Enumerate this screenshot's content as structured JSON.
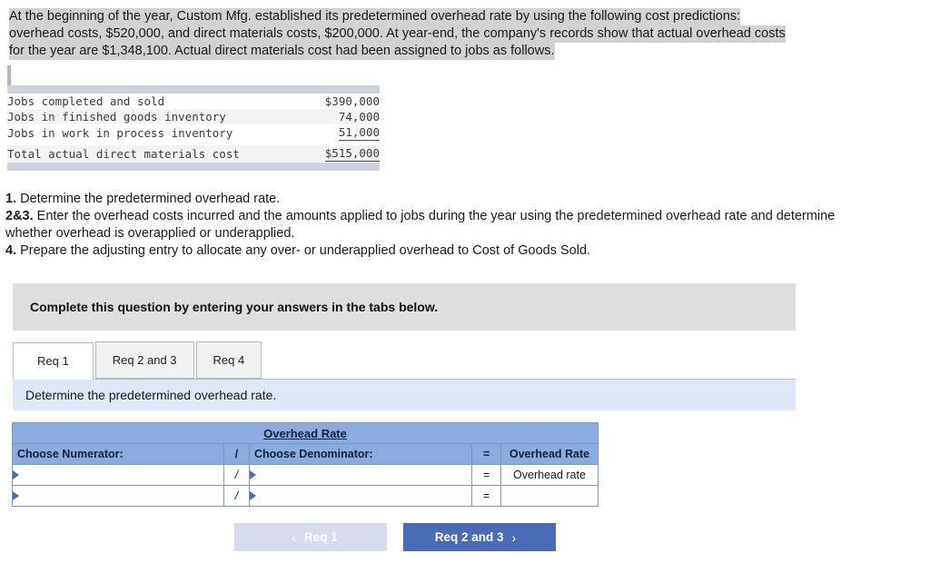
{
  "problem": {
    "line1": "At the beginning of the year, Custom Mfg. established its predetermined overhead rate by using the following cost predictions:",
    "line2": "overhead costs, $520,000, and direct materials costs, $200,000. At year-end, the company's records show that actual overhead costs",
    "line3": "for the year are $1,348,100. Actual direct materials cost had been assigned to jobs as follows."
  },
  "exhibit": {
    "rows": [
      {
        "label": "Jobs completed and sold",
        "amount": "$390,000",
        "underline": "none"
      },
      {
        "label": "Jobs in finished goods inventory",
        "amount": "74,000",
        "underline": "none"
      },
      {
        "label": "Jobs in work in process inventory",
        "amount": "51,000",
        "underline": "single"
      },
      {
        "label": "Total actual direct materials cost",
        "amount": "$515,000",
        "underline": "single"
      }
    ]
  },
  "requirements": {
    "r1_num": "1.",
    "r1_text": " Determine the predetermined overhead rate.",
    "r2_num": "2&3.",
    "r2_text": " Enter the overhead costs incurred and the amounts applied to jobs during the year using the predetermined overhead rate and determine whether overhead is overapplied or underapplied.",
    "r4_num": "4.",
    "r4_text": " Prepare the adjusting entry to allocate any over- or underapplied overhead to Cost of Goods Sold."
  },
  "banner": {
    "text": "Complete this question by entering your answers in the tabs below."
  },
  "tabs": [
    {
      "label": "Req 1",
      "active": true
    },
    {
      "label": "Req 2 and 3",
      "active": false
    },
    {
      "label": "Req 4",
      "active": false
    }
  ],
  "subinfo": {
    "text": "Determine the predetermined overhead rate."
  },
  "answer_table": {
    "title": "Overhead Rate",
    "headers": {
      "numerator": "Choose Numerator:",
      "slash": "/",
      "denominator": "Choose Denominator:",
      "equals": "=",
      "rate": "Overhead Rate"
    },
    "rows": [
      {
        "numerator_value": "",
        "slash": "/",
        "denominator_value": "",
        "equals": "=",
        "rate_value": "Overhead rate"
      },
      {
        "numerator_value": "",
        "slash": "/",
        "denominator_value": "",
        "equals": "=",
        "rate_value": ""
      }
    ]
  },
  "nav": {
    "prev_label": "Req 1",
    "prev_chevron": "‹",
    "next_label": "Req 2 and 3",
    "next_chevron": "›"
  },
  "colors": {
    "header_blue": "#8bace0",
    "button_blue": "#4a6bb5",
    "info_blue": "#dce8f5",
    "banner_gray": "#dedede",
    "highlight_gray": "#d2d2d2"
  }
}
